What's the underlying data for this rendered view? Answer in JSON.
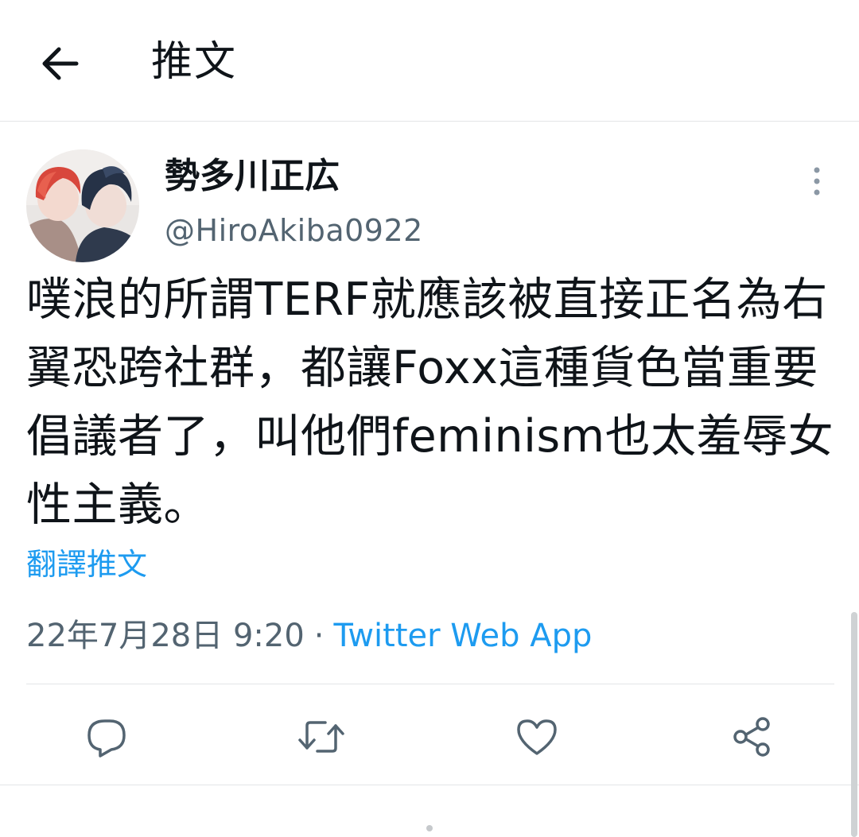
{
  "header": {
    "back_icon": "arrow-left-icon",
    "title": "推文"
  },
  "author": {
    "display_name": "勢多川正広",
    "handle": "@HiroAkiba0922",
    "avatar_icon": "avatar-illustration",
    "more_icon": "more-vertical-icon"
  },
  "tweet": {
    "text": "噗浪的所謂TERF就應該被直接正名為右翼恐跨社群，都讓Foxx這種貨色當重要倡議者了，叫他們feminism也太羞辱女性主義。",
    "translate_label": "翻譯推文",
    "date": "22年7月28日 9:20",
    "separator": "·",
    "source": "Twitter Web App"
  },
  "actions": [
    {
      "icon": "reply-icon"
    },
    {
      "icon": "retweet-icon"
    },
    {
      "icon": "like-heart-icon"
    },
    {
      "icon": "share-icon"
    }
  ],
  "colors": {
    "text": "#0f1419",
    "secondary": "#536471",
    "link": "#1d9bf0",
    "icon": "#536471",
    "border": "#e3e5e7"
  }
}
